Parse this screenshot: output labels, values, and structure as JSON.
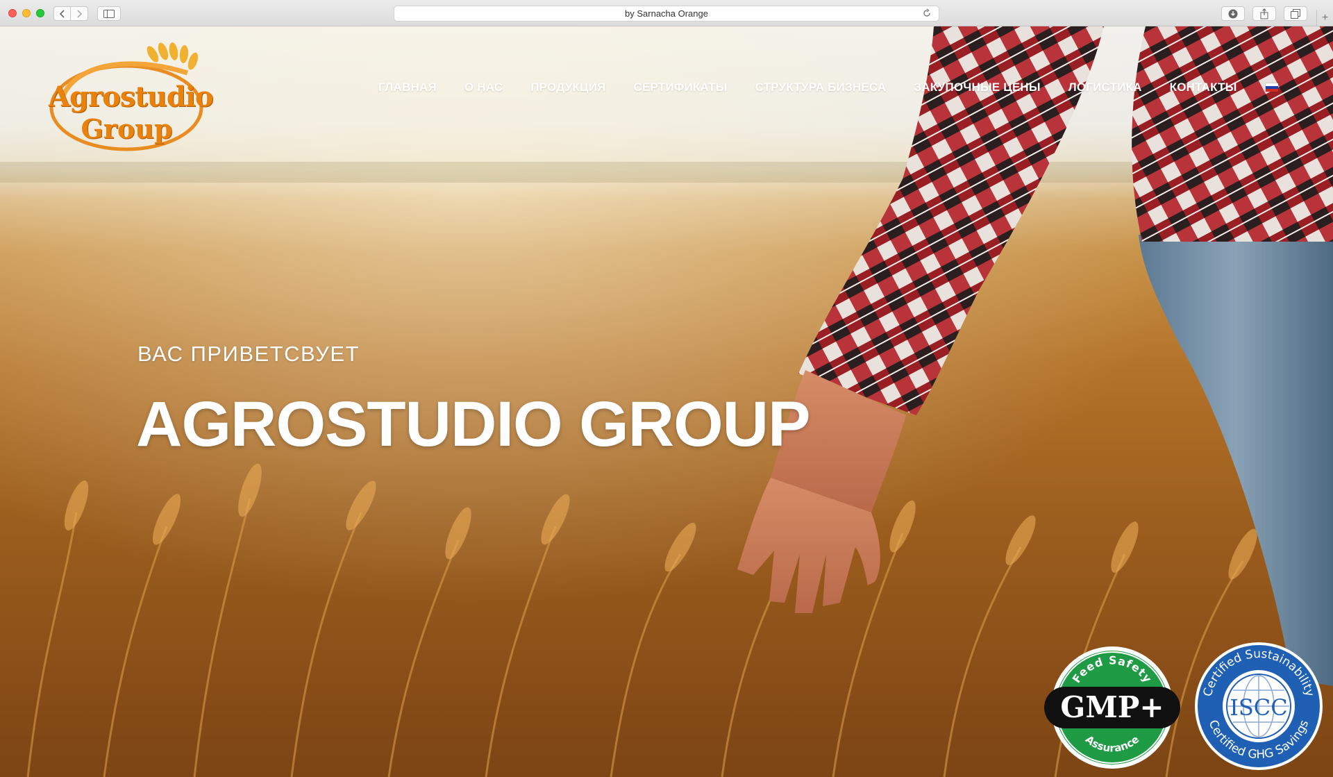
{
  "browser": {
    "url_text": "by Sarnacha Orange",
    "new_tab_label": "+"
  },
  "site": {
    "logo": {
      "line1": "Agrostudio",
      "line2": "Group"
    },
    "nav": [
      {
        "label": "ГЛАВНАЯ"
      },
      {
        "label": "О НАС"
      },
      {
        "label": "ПРОДУКЦИЯ"
      },
      {
        "label": "СЕРТИФИКАТЫ"
      },
      {
        "label": "СТРУКТУРА БИЗНЕСА"
      },
      {
        "label": "ЗАКУПОЧНЫЕ ЦЕНЫ"
      },
      {
        "label": "ЛОГИСТИКА"
      },
      {
        "label": "КОНТАКТЫ"
      }
    ],
    "language_flag": "flag-ru-icon",
    "hero": {
      "welcome": "ВАС ПРИВЕТСВУЕТ",
      "headline": "AGROSTUDIO GROUP"
    },
    "badges": {
      "gmp": {
        "top_text": "Feed Safety",
        "main": "GMP+",
        "bottom_text": "Assurance"
      },
      "iscc": {
        "top_text": "Certified Sustainability",
        "main": "ISCC",
        "bottom_text": "Certified GHG Savings"
      }
    }
  },
  "colors": {
    "accent_orange": "#e8820c",
    "gmp_green": "#1f9a45",
    "iscc_blue": "#1f5fb4"
  }
}
